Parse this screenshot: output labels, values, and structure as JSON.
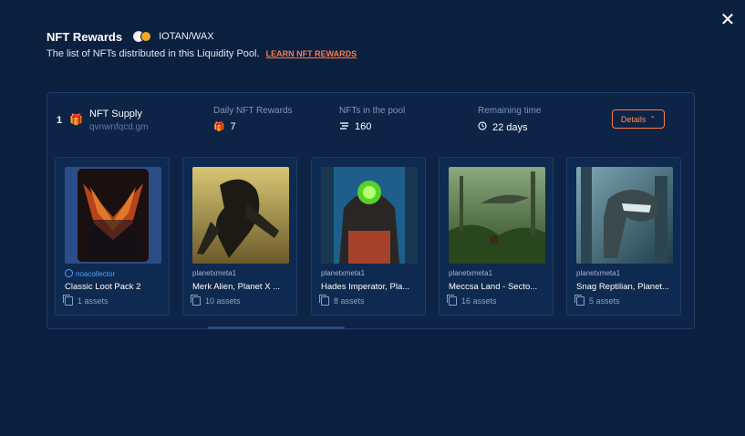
{
  "header": {
    "title": "NFT Rewards",
    "pair": "IOTAN/WAX",
    "subtitle": "The list of NFTs distributed in this Liquidity Pool.",
    "learn_link": "LEARN NFT REWARDS"
  },
  "supply": {
    "rank": "1",
    "name": "NFT Supply",
    "account": "qvnwnfqcd.gm",
    "stats": [
      {
        "label": "Daily NFT Rewards",
        "value": "7",
        "icon": "gift-icon"
      },
      {
        "label": "NFTs in the pool",
        "value": "160",
        "icon": "pool-icon"
      },
      {
        "label": "Remaining time",
        "value": "22 days",
        "icon": "clock-icon"
      }
    ],
    "details_label": "Details"
  },
  "cards": [
    {
      "creator": "noacollector",
      "name": "Classic Loot Pack 2",
      "assets": "1 assets"
    },
    {
      "creator": "planetxmeta1",
      "name": "Merk Alien, Planet X ...",
      "assets": "10 assets"
    },
    {
      "creator": "planetxmeta1",
      "name": "Hades Imperator, Pla...",
      "assets": "8 assets"
    },
    {
      "creator": "planetxmeta1",
      "name": "Meccsa Land - Secto...",
      "assets": "16 assets"
    },
    {
      "creator": "planetxmeta1",
      "name": "Snag Reptilian, Planet...",
      "assets": "5 assets"
    }
  ],
  "colors": {
    "background": "#0b1f3f",
    "accent": "#ff7a45",
    "verified": "#4aa3ff"
  }
}
